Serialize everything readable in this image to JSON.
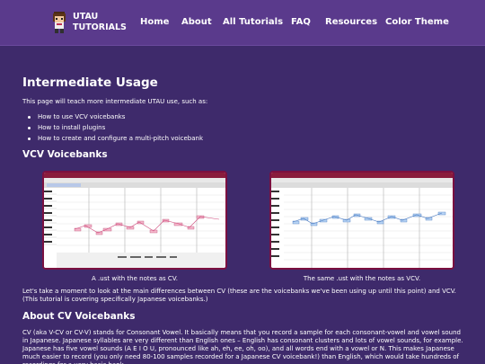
{
  "site": {
    "logo_line1": "UTAU",
    "logo_line2": "TUTORIALS"
  },
  "nav": {
    "items": [
      "Home",
      "About",
      "All Tutorials",
      "FAQ",
      "Resources",
      "Color Theme"
    ]
  },
  "page": {
    "title": "Intermediate Usage",
    "intro": "This page will teach more intermediate UTAU use, such as:",
    "bullets": [
      "How to use VCV voicebanks",
      "How to install plugins",
      "How to create and configure a multi-pitch voicebank"
    ]
  },
  "vcv_section": {
    "heading": "VCV Voicebanks",
    "caption_left": "A .ust with the notes as CV.",
    "caption_right": "The same .ust with the notes as VCV.",
    "paragraph": "Let's take a moment to look at the main differences between CV (these are the voicebanks we've been using up until this point) and VCV. (This tutorial is covering specifically Japanese voicebanks.)"
  },
  "cv_section": {
    "heading": "About CV Voicebanks",
    "paragraph": "CV (aka V-CV or CV-V) stands for Consonant Vowel. It basically means that you record a sample for each consonant-vowel and vowel sound in Japanese. Japanese syllables are very different than English ones – English has consonant clusters and lots of vowel sounds, for example. Japanese has five vowel sounds (A E I O U, pronounced like ah, eh, ee, oh, oo), and all words end with a vowel or N. This makes Japanese much easier to record (you only need 80-100 samples recorded for a Japanese CV voicebank!) than English, which would take hundreds of recordings for a very basic bank."
  },
  "colors": {
    "background": "#3e2a6b",
    "header": "#5a3a8c",
    "screenshot_border": "#7b1040"
  }
}
